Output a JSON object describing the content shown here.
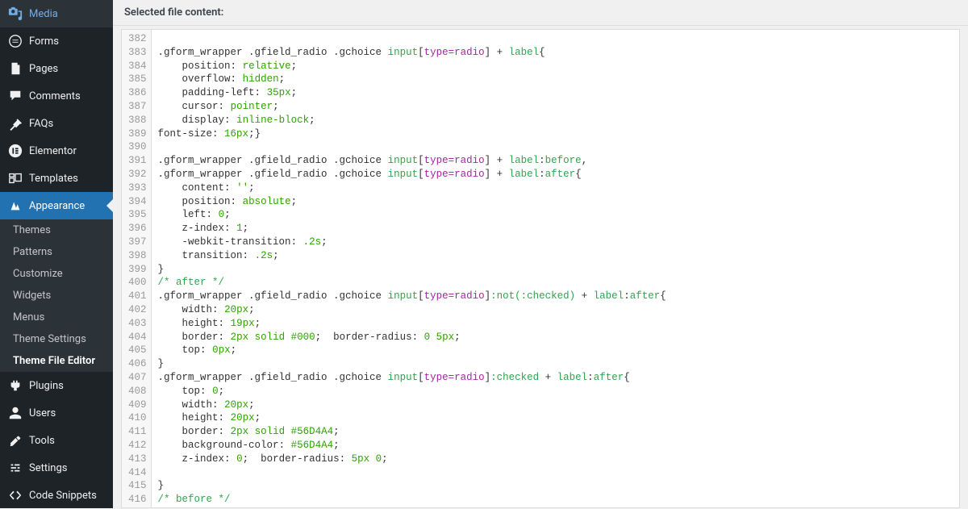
{
  "header": {
    "label": "Selected file content:"
  },
  "sidebar": {
    "items": [
      {
        "label": "Media",
        "icon": "media"
      },
      {
        "label": "Forms",
        "icon": "forms"
      },
      {
        "label": "Pages",
        "icon": "pages"
      },
      {
        "label": "Comments",
        "icon": "comments"
      },
      {
        "label": "FAQs",
        "icon": "pin"
      },
      {
        "label": "Elementor",
        "icon": "elementor"
      },
      {
        "label": "Templates",
        "icon": "templates"
      },
      {
        "label": "Appearance",
        "icon": "appearance",
        "active": true
      },
      {
        "label": "Plugins",
        "icon": "plugins"
      },
      {
        "label": "Users",
        "icon": "users"
      },
      {
        "label": "Tools",
        "icon": "tools"
      },
      {
        "label": "Settings",
        "icon": "settings"
      },
      {
        "label": "Code Snippets",
        "icon": "snippets"
      }
    ],
    "submenu": [
      "Themes",
      "Patterns",
      "Customize",
      "Widgets",
      "Menus",
      "Theme Settings",
      "Theme File Editor"
    ],
    "submenu_current": "Theme File Editor"
  },
  "code": {
    "first_line": 382,
    "lines": [
      {
        "n": 382,
        "t": ""
      },
      {
        "n": 383,
        "t": ".gform_wrapper .gfield_radio .gchoice input[type=radio] + label{",
        "tokenize": true
      },
      {
        "n": 384,
        "t": "    position: relative;",
        "kv": [
          "position",
          "relative"
        ]
      },
      {
        "n": 385,
        "t": "    overflow: hidden;",
        "kv": [
          "overflow",
          "hidden"
        ]
      },
      {
        "n": 386,
        "t": "    padding-left: 35px;",
        "kv": [
          "padding-left",
          "35px"
        ]
      },
      {
        "n": 387,
        "t": "    cursor: pointer;",
        "kv": [
          "cursor",
          "pointer"
        ]
      },
      {
        "n": 388,
        "t": "    display: inline-block;",
        "kv": [
          "display",
          "inline-block"
        ]
      },
      {
        "n": 389,
        "t": "font-size: 16px;}",
        "kv": [
          "font-size",
          "16px"
        ],
        "close": true,
        "noIndent": true
      },
      {
        "n": 390,
        "t": ""
      },
      {
        "n": 391,
        "t": ".gform_wrapper .gfield_radio .gchoice input[type=radio] + label:before,",
        "tokenize": true,
        "pseudo": "before",
        "tail": ","
      },
      {
        "n": 392,
        "t": ".gform_wrapper .gfield_radio .gchoice input[type=radio] + label:after{",
        "tokenize": true,
        "pseudo": "after"
      },
      {
        "n": 393,
        "t": "    content: '';",
        "kv": [
          "content",
          "''"
        ]
      },
      {
        "n": 394,
        "t": "    position: absolute;",
        "kv": [
          "position",
          "absolute"
        ]
      },
      {
        "n": 395,
        "t": "    left: 0;",
        "kv": [
          "left",
          "0"
        ]
      },
      {
        "n": 396,
        "t": "    z-index: 1;",
        "kv": [
          "z-index",
          "1"
        ]
      },
      {
        "n": 397,
        "t": "    -webkit-transition: .2s;",
        "kv": [
          "-webkit-transition",
          ".2s"
        ],
        "prefix": "-webkit-"
      },
      {
        "n": 398,
        "t": "    transition: .2s;",
        "kv": [
          "transition",
          ".2s"
        ]
      },
      {
        "n": 399,
        "t": "}",
        "closeOnly": true
      },
      {
        "n": 400,
        "t": "/* after */",
        "comment": true
      },
      {
        "n": 401,
        "t": ".gform_wrapper .gfield_radio .gchoice input[type=radio]:not(:checked) + label:after{",
        "tokenize": true,
        "pseudoInput": ":not(:checked)",
        "pseudo": "after"
      },
      {
        "n": 402,
        "t": "    width: 20px;",
        "kv": [
          "width",
          "20px"
        ]
      },
      {
        "n": 403,
        "t": "    height: 19px;",
        "kv": [
          "height",
          "19px"
        ]
      },
      {
        "n": 404,
        "t": "    border: 2px solid #000;  border-radius: 0 5px;",
        "multi": [
          [
            "border",
            "2px solid #000"
          ],
          [
            "border-radius",
            "0 5px"
          ]
        ]
      },
      {
        "n": 405,
        "t": "    top: 0px;",
        "kv": [
          "top",
          "0px"
        ]
      },
      {
        "n": 406,
        "t": "}",
        "closeOnly": true
      },
      {
        "n": 407,
        "t": ".gform_wrapper .gfield_radio .gchoice input[type=radio]:checked + label:after{",
        "tokenize": true,
        "pseudoInput": ":checked",
        "pseudo": "after"
      },
      {
        "n": 408,
        "t": "    top: 0;",
        "kv": [
          "top",
          "0"
        ]
      },
      {
        "n": 409,
        "t": "    width: 20px;",
        "kv": [
          "width",
          "20px"
        ]
      },
      {
        "n": 410,
        "t": "    height: 20px;",
        "kv": [
          "height",
          "20px"
        ]
      },
      {
        "n": 411,
        "t": "    border: 2px solid #56D4A4;",
        "kv": [
          "border",
          "2px solid #56D4A4"
        ]
      },
      {
        "n": 412,
        "t": "    background-color: #56D4A4;",
        "kv": [
          "background-color",
          "#56D4A4"
        ]
      },
      {
        "n": 413,
        "t": "    z-index: 0;  border-radius: 5px 0;",
        "multi": [
          [
            "z-index",
            "0"
          ],
          [
            "border-radius",
            "5px 0"
          ]
        ]
      },
      {
        "n": 414,
        "t": ""
      },
      {
        "n": 415,
        "t": "}",
        "closeOnly": true
      },
      {
        "n": 416,
        "t": "/* before */",
        "comment": true
      }
    ]
  }
}
